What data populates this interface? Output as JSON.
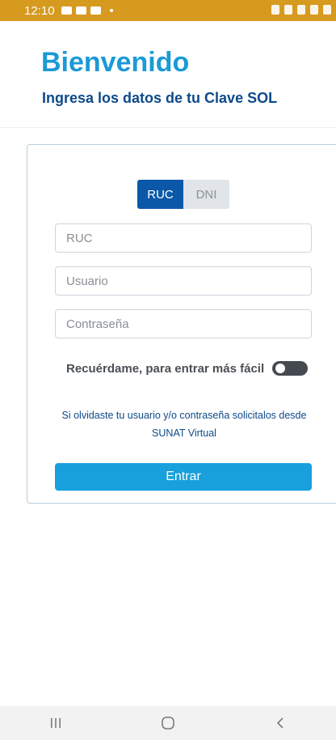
{
  "status_bar": {
    "time": "12:10",
    "icons": [
      "photo-icon",
      "gallery-icon",
      "message-icon",
      "battery-saver-icon",
      "alarm-icon",
      "data-icon",
      "signal-icon",
      "battery-icon"
    ]
  },
  "header": {
    "title": "Bienvenido",
    "subtitle": "Ingresa los datos de tu Clave SOL"
  },
  "doc_toggle": {
    "options": [
      {
        "label": "RUC",
        "selected": true
      },
      {
        "label": "DNI",
        "selected": false
      }
    ]
  },
  "form": {
    "ruc_placeholder": "RUC",
    "user_placeholder": "Usuario",
    "password_placeholder": "Contraseña",
    "remember_label": "Recuérdame, para entrar más fácil",
    "remember_enabled": false,
    "help_text": "Si olvidaste tu usuario y/o contraseña solicitalos desde SUNAT Virtual",
    "submit_label": "Entrar"
  },
  "colors": {
    "status_bar": "#d69a1e",
    "title": "#1a9ad6",
    "subtitle": "#0d4a8a",
    "tab_active": "#0b58a8",
    "submit": "#18a0dc"
  },
  "nav_bar": {
    "buttons": [
      "recent-apps-icon",
      "home-icon",
      "back-icon"
    ]
  }
}
